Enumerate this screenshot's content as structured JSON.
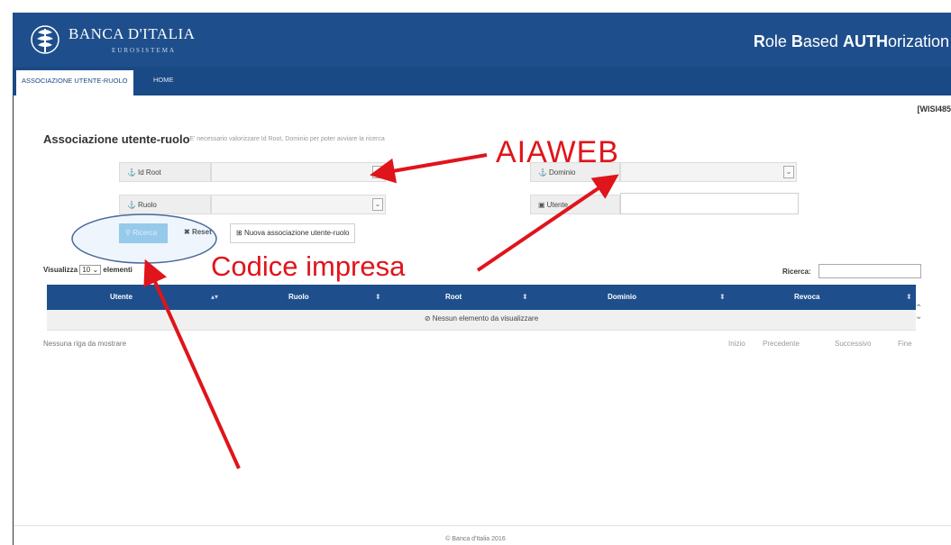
{
  "header": {
    "brand": "BANCA D'ITALIA",
    "brand_sub": "EUROSISTEMA",
    "app_title_parts": [
      {
        "text": "R",
        "bold": true
      },
      {
        "text": "ole ",
        "bold": false
      },
      {
        "text": "B",
        "bold": true
      },
      {
        "text": "ased ",
        "bold": false
      },
      {
        "text": "AUTH",
        "bold": true
      },
      {
        "text": "orization",
        "bold": false
      }
    ]
  },
  "nav": {
    "tabs": [
      {
        "label": "ASSOCIAZIONE UTENTE-RUOLO",
        "active": true
      },
      {
        "label": "HOME",
        "active": false
      }
    ]
  },
  "user_code": "[WISI485",
  "page": {
    "title": "Associazione utente-ruolo",
    "hint": "- E' necessario valorizzare Id Root, Dominio per poter avviare la ricerca"
  },
  "form": {
    "id_root_label": "Id Root",
    "dominio_label": "Dominio",
    "ruolo_label": "Ruolo",
    "utente_label": "Utente",
    "utente_value": ""
  },
  "buttons": {
    "ricerca": "Ricerca",
    "reset": "Reset",
    "nuova": "Nuova associazione utente-ruolo"
  },
  "table_controls": {
    "show_prefix": "Visualizza",
    "page_length": "10",
    "show_suffix": "elementi",
    "search_label": "Ricerca:",
    "search_value": ""
  },
  "table": {
    "columns": [
      "Utente",
      "Ruolo",
      "Root",
      "Dominio",
      "Revoca"
    ],
    "empty_message": "Nessun elemento da visualizzare",
    "info": "Nessuna riga da mostrare",
    "pager": [
      "Inizio",
      "Precedente",
      "Successivo",
      "Fine"
    ]
  },
  "footer": {
    "copyright": "© Banca d'Italia 2016"
  },
  "annotations": {
    "label_aiaweb": "AIAWEB",
    "label_codice": "Codice impresa",
    "color": "#e0141b"
  },
  "colors": {
    "header_bg": "#1e4f8c",
    "nav_bg": "#1a4a85",
    "primary_btn": "#8ec8ea"
  }
}
